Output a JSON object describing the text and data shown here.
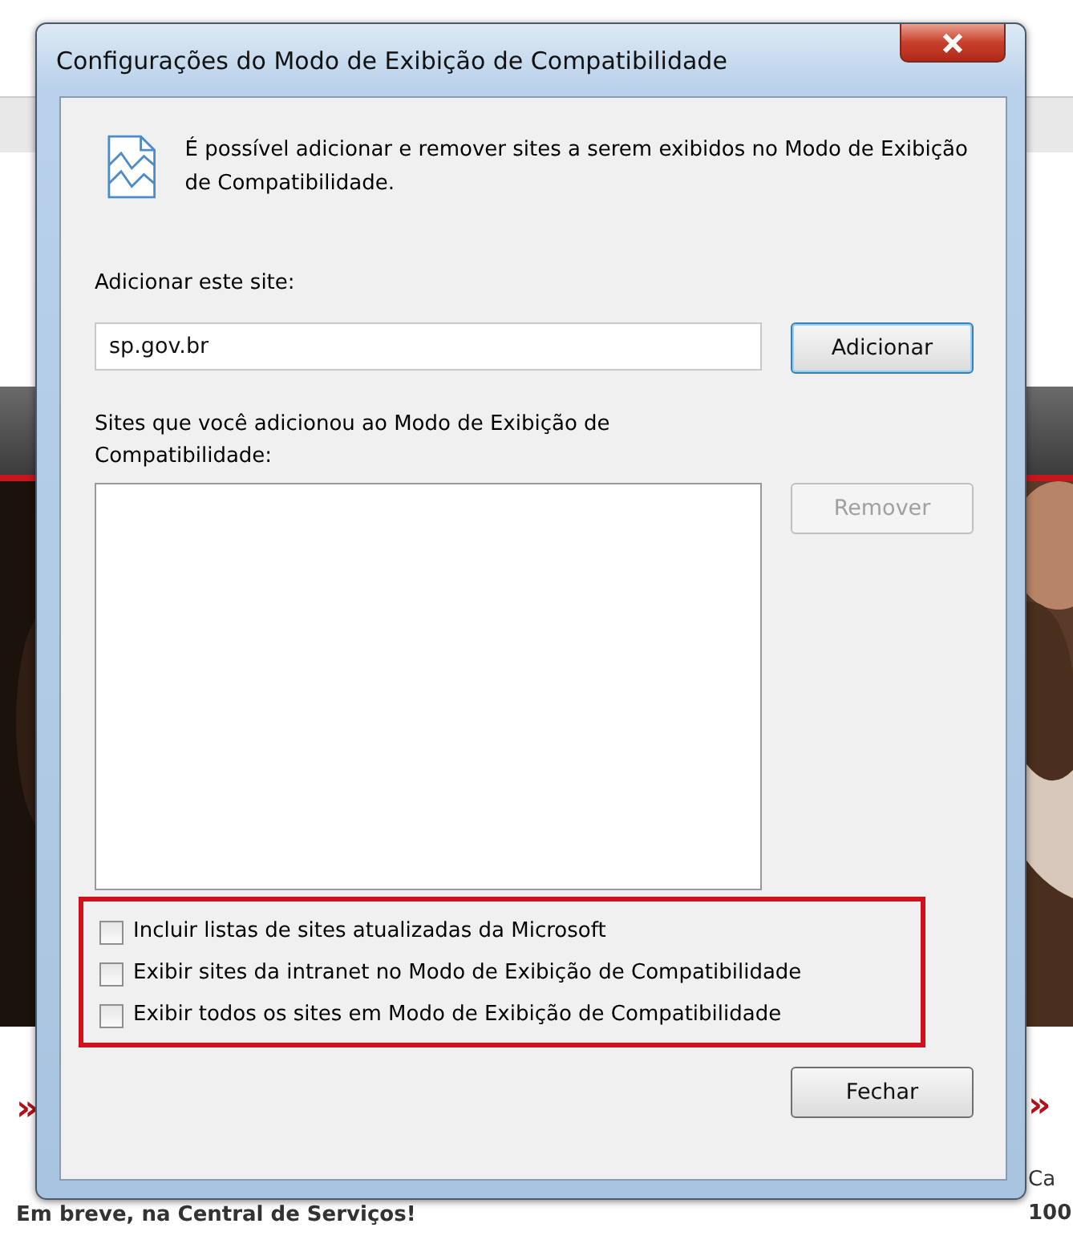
{
  "background_page": {
    "left_marker": "»",
    "headline": "Em breve, na Central de Serviços!",
    "right_marker": "»",
    "right_text_1": "Ca",
    "right_text_2": "100"
  },
  "dialog": {
    "title": "Configurações do Modo de Exibição de Compatibilidade",
    "intro": "É possível adicionar e remover sites a serem exibidos no Modo de Exibição de Compatibilidade.",
    "add_label": "Adicionar este site:",
    "add_value": "sp.gov.br",
    "add_button": {
      "label": "Adicionar",
      "focused": true
    },
    "list_label": "Sites que você adicionou ao Modo de Exibição de Compatibilidade:",
    "remove_button": {
      "label": "Remover",
      "disabled": true
    },
    "options_highlighted": true,
    "options": [
      {
        "label": "Incluir listas de sites atualizadas da Microsoft",
        "checked": false
      },
      {
        "label": "Exibir sites da intranet no Modo de Exibição de Compatibilidade",
        "checked": false
      },
      {
        "label": "Exibir todos os sites em Modo de Exibição de Compatibilidade",
        "checked": false
      }
    ],
    "close_button": {
      "label": "Fechar",
      "disabled": false
    }
  }
}
